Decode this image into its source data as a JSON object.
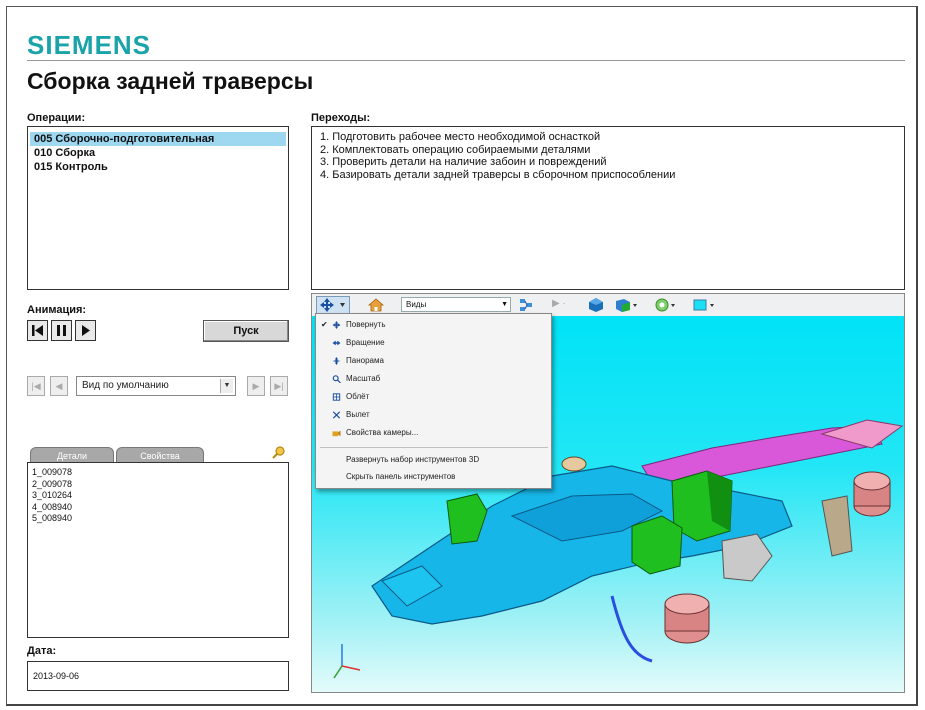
{
  "brand": {
    "logo": "SIEMENS"
  },
  "page": {
    "title": "Сборка задней траверсы"
  },
  "operations": {
    "label": "Операции:",
    "items": [
      {
        "text": "005 Сборочно-подготовительная",
        "selected": true
      },
      {
        "text": "010 Сборка",
        "selected": false
      },
      {
        "text": "015 Контроль",
        "selected": false
      }
    ]
  },
  "transitions": {
    "label": "Переходы:",
    "items": [
      "1. Подготовить рабочее место необходимой оснасткой",
      "2. Комплектовать операцию собираемыми деталями",
      "3. Проверить детали на наличие забоин и повреждений",
      "4. Базировать детали задней траверсы в сборочном приспособлении"
    ]
  },
  "animation": {
    "label": "Анимация:",
    "play_label": "Пуск",
    "view_select": "Вид по умолчанию"
  },
  "parts_panel": {
    "tabs": [
      "Детали",
      "Свойства"
    ],
    "items": [
      "1_009078",
      "2_009078",
      "3_010264",
      "4_008940",
      "5_008940"
    ]
  },
  "date": {
    "label": "Дата:",
    "value": "2013-09-06"
  },
  "viewer_toolbar": {
    "views_combo": "Виды"
  },
  "context_menu": {
    "items": [
      {
        "label": "Повернуть",
        "checked": true,
        "icon": "rotate-icon"
      },
      {
        "label": "Вращение",
        "checked": false,
        "icon": "spin-icon"
      },
      {
        "label": "Панорама",
        "checked": false,
        "icon": "pan-icon"
      },
      {
        "label": "Масштаб",
        "checked": false,
        "icon": "zoom-icon"
      },
      {
        "label": "Облёт",
        "checked": false,
        "icon": "fly-icon"
      },
      {
        "label": "Вылет",
        "checked": false,
        "icon": "walk-icon"
      },
      {
        "label": "Свойства камеры...",
        "checked": false,
        "icon": "camera-icon"
      }
    ],
    "extra_items": [
      "Развернуть набор инструментов 3D",
      "Скрыть панель инструментов"
    ]
  },
  "colors": {
    "brand": "#1aa3a8",
    "selection": "#9ed7f0",
    "scene_top": "#00e3f7",
    "model_blue": "#19b9e8",
    "model_green": "#1fbf1f",
    "model_pink": "#e08f8f",
    "model_magenta": "#e060e0"
  }
}
